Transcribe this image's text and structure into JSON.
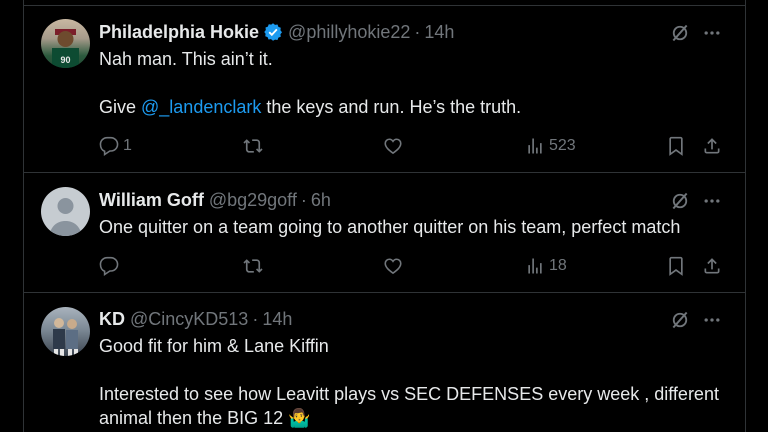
{
  "tweets": [
    {
      "name": "Philadelphia Hokie",
      "handle": "@phillyhokie22",
      "sep": "·",
      "time": "14h",
      "line1": "Nah man. This ain’t it.",
      "line2_pre": "Give ",
      "mention": "@_landenclark",
      "line2_post": " the keys and run. He’s the truth.",
      "replies": "1",
      "views": "523"
    },
    {
      "name": "William Goff",
      "handle": "@bg29goff",
      "sep": "·",
      "time": "6h",
      "line1": "One quitter on a team going to another quitter on his team, perfect match",
      "views": "18"
    },
    {
      "name": "KD",
      "handle": "@CincyKD513",
      "sep": "·",
      "time": "14h",
      "line1": "Good fit for him & Lane Kiffin",
      "line2": "Interested to see how Leavitt plays vs SEC DEFENSES every week , different",
      "line3": "animal then the BIG 12 🤷‍♂️"
    }
  ],
  "colors": {
    "background": "#000000",
    "text": "#e7e9ea",
    "muted": "#71767b",
    "link": "#1d9bf0",
    "divider": "#2f3336"
  },
  "icons": [
    "verified-badge-icon",
    "grok-icon",
    "more-icon",
    "reply-icon",
    "repost-icon",
    "like-icon",
    "views-icon",
    "bookmark-icon",
    "share-icon"
  ]
}
